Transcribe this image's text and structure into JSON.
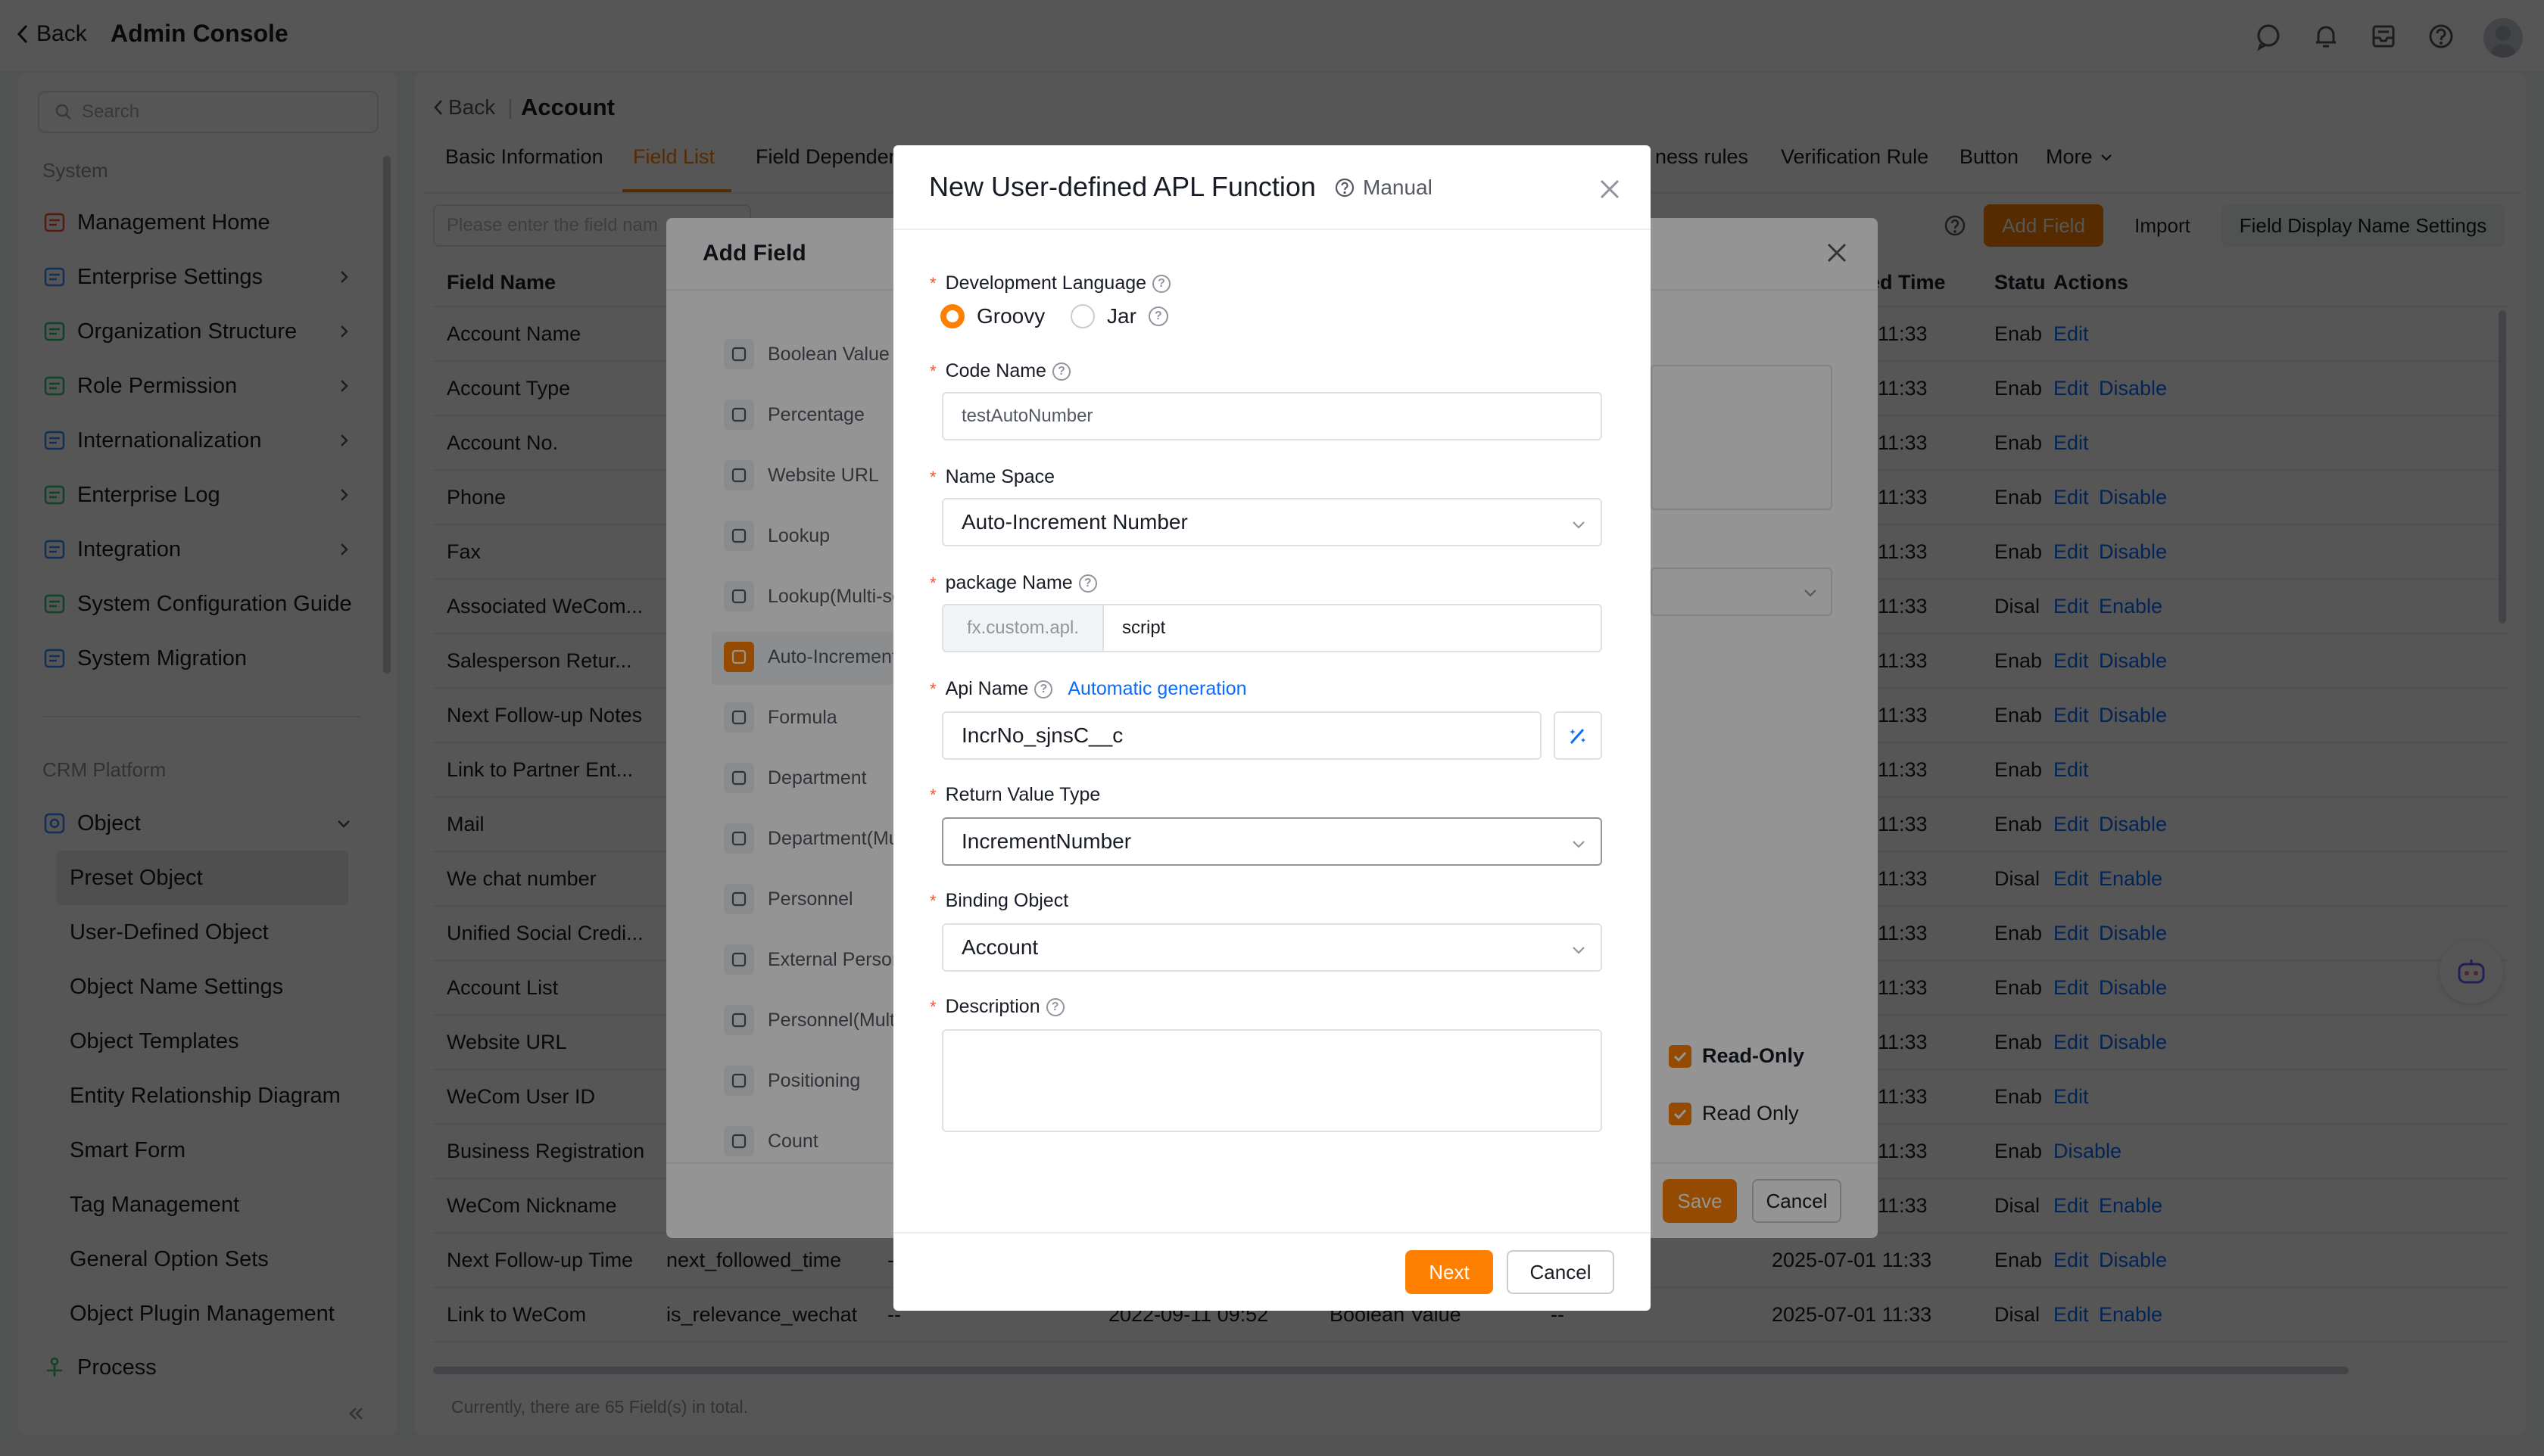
{
  "topbar": {
    "back": "Back",
    "title": "Admin Console"
  },
  "sidebar": {
    "search_placeholder": "Search",
    "system_label": "System",
    "system_items": [
      {
        "label": "Management Home",
        "icon": "home-icon",
        "color": "#ff522a"
      },
      {
        "label": "Enterprise Settings",
        "icon": "building-icon",
        "color": "#368dff"
      },
      {
        "label": "Organization Structure",
        "icon": "org-chart-icon",
        "color": "#30c776"
      },
      {
        "label": "Role Permission",
        "icon": "id-card-icon",
        "color": "#30c776"
      },
      {
        "label": "Internationalization",
        "icon": "globe-icon",
        "color": "#368dff"
      },
      {
        "label": "Enterprise Log",
        "icon": "log-icon",
        "color": "#30c776"
      },
      {
        "label": "Integration",
        "icon": "integration-icon",
        "color": "#368dff"
      },
      {
        "label": "System Configuration Guide",
        "icon": "guide-icon",
        "color": "#30c776"
      },
      {
        "label": "System Migration",
        "icon": "migration-icon",
        "color": "#368dff"
      }
    ],
    "crm_label": "CRM Platform",
    "object_label": "Object",
    "object_items": [
      "Preset Object",
      "User-Defined Object",
      "Object Name Settings",
      "Object Templates",
      "Entity Relationship Diagram",
      "Smart Form",
      "Tag Management",
      "General Option Sets",
      "Object Plugin Management"
    ],
    "process_label": "Process"
  },
  "account": {
    "back": "Back",
    "title": "Account",
    "tabs": [
      "Basic Information",
      "Field List",
      "Field Dependen",
      "ness rules",
      "Verification Rule",
      "Button",
      "More"
    ],
    "search_placeholder": "Please enter the field nam",
    "add_field": "Add Field",
    "import": "Import",
    "display_settings": "Field Display Name Settings",
    "headers": {
      "field_name": "Field Name",
      "time": "ed Time",
      "status": "Statu",
      "actions": "Actions"
    },
    "rows": [
      {
        "name": "Account Name",
        "time": "11:33",
        "status": "Enab",
        "a1": "Edit",
        "a2": ""
      },
      {
        "name": "Account Type",
        "time": "11:33",
        "status": "Enab",
        "a1": "Edit",
        "a2": "Disable"
      },
      {
        "name": "Account No.",
        "time": "11:33",
        "status": "Enab",
        "a1": "Edit",
        "a2": ""
      },
      {
        "name": "Phone",
        "time": "11:33",
        "status": "Enab",
        "a1": "Edit",
        "a2": "Disable"
      },
      {
        "name": "Fax",
        "time": "11:33",
        "status": "Enab",
        "a1": "Edit",
        "a2": "Disable"
      },
      {
        "name": "Associated WeCom...",
        "time": "11:33",
        "status": "Disal",
        "a1": "Edit",
        "a2": "Enable"
      },
      {
        "name": "Salesperson Retur...",
        "time": "11:33",
        "status": "Enab",
        "a1": "Edit",
        "a2": "Disable"
      },
      {
        "name": "Next Follow-up Notes",
        "time": "11:33",
        "status": "Enab",
        "a1": "Edit",
        "a2": "Disable"
      },
      {
        "name": "Link to Partner Ent...",
        "time": "11:33",
        "status": "Enab",
        "a1": "Edit",
        "a2": ""
      },
      {
        "name": "Mail",
        "time": "11:33",
        "status": "Enab",
        "a1": "Edit",
        "a2": "Disable"
      },
      {
        "name": "We chat number",
        "time": "11:33",
        "status": "Disal",
        "a1": "Edit",
        "a2": "Enable"
      },
      {
        "name": "Unified Social Credi...",
        "time": "11:33",
        "status": "Enab",
        "a1": "Edit",
        "a2": "Disable"
      },
      {
        "name": "Account List",
        "time": "11:33",
        "status": "Enab",
        "a1": "Edit",
        "a2": "Disable"
      },
      {
        "name": "Website URL",
        "time": "11:33",
        "status": "Enab",
        "a1": "Edit",
        "a2": "Disable"
      },
      {
        "name": "WeCom User ID",
        "time": "11:33",
        "status": "Enab",
        "a1": "Edit",
        "a2": ""
      },
      {
        "name": "Business Registration",
        "time": "11:33",
        "status": "Enab",
        "a1": "Disable",
        "a2": ""
      },
      {
        "name": "WeCom Nickname",
        "time": "11:33",
        "status": "Disal",
        "a1": "Edit",
        "a2": "Enable"
      },
      {
        "name": "Next Follow-up Time",
        "api": "next_followed_time",
        "dash": "--",
        "time": "2025-07-01 11:33",
        "status": "Enab",
        "a1": "Edit",
        "a2": "Disable"
      },
      {
        "name": "Link to WeCom",
        "api": "is_relevance_wechat",
        "dash": "--",
        "created": "2022-09-11 09:52",
        "type": "Boolean Value",
        "dash2": "--",
        "time": "2025-07-01 11:33",
        "status": "Disal",
        "a1": "Edit",
        "a2": "Enable"
      }
    ],
    "footer": "Currently, there are 65 Field(s) in total."
  },
  "add_field": {
    "title": "Add Field",
    "types": [
      {
        "label": "Boolean Value",
        "icon": "toggle-icon"
      },
      {
        "label": "Percentage",
        "icon": "percent-icon"
      },
      {
        "label": "Website URL",
        "icon": "globe-icon"
      },
      {
        "label": "Lookup",
        "icon": "lookup-icon"
      },
      {
        "label": "Lookup(Multi-se",
        "icon": "lookup-multi-icon"
      },
      {
        "label": "Auto-Increment",
        "icon": "list-icon"
      },
      {
        "label": "Formula",
        "icon": "formula-icon"
      },
      {
        "label": "Department",
        "icon": "department-icon"
      },
      {
        "label": "Department(Mu",
        "icon": "department-multi-icon"
      },
      {
        "label": "Personnel",
        "icon": "person-icon"
      },
      {
        "label": "External Persor",
        "icon": "external-person-icon"
      },
      {
        "label": "Personnel(Multi",
        "icon": "person-multi-icon"
      },
      {
        "label": "Positioning",
        "icon": "location-icon"
      },
      {
        "label": "Count",
        "icon": "count-icon"
      }
    ],
    "read_only_bold": "Read-Only",
    "read_only": "Read Only",
    "save": "Save",
    "cancel": "Cancel"
  },
  "apl_modal": {
    "title": "New User-defined APL Function",
    "manual": "Manual",
    "dev_lang_label": "Development Language",
    "lang_groovy": "Groovy",
    "lang_jar": "Jar",
    "code_name_label": "Code Name",
    "code_name_value": "testAutoNumber",
    "namespace_label": "Name Space",
    "namespace_value": "Auto-Increment Number",
    "package_label": "package Name",
    "package_prefix": "fx.custom.apl.",
    "package_value": "script",
    "api_name_label": "Api Name",
    "auto_generation": "Automatic generation",
    "api_name_value": "IncrNo_sjnsC__c",
    "return_type_label": "Return Value Type",
    "return_type_value": "IncrementNumber",
    "binding_label": "Binding Object",
    "binding_value": "Account",
    "description_label": "Description",
    "next": "Next",
    "cancel": "Cancel"
  },
  "colors": {
    "accent": "#ff8000",
    "link": "#0c6cff",
    "required": "#ff522a"
  }
}
